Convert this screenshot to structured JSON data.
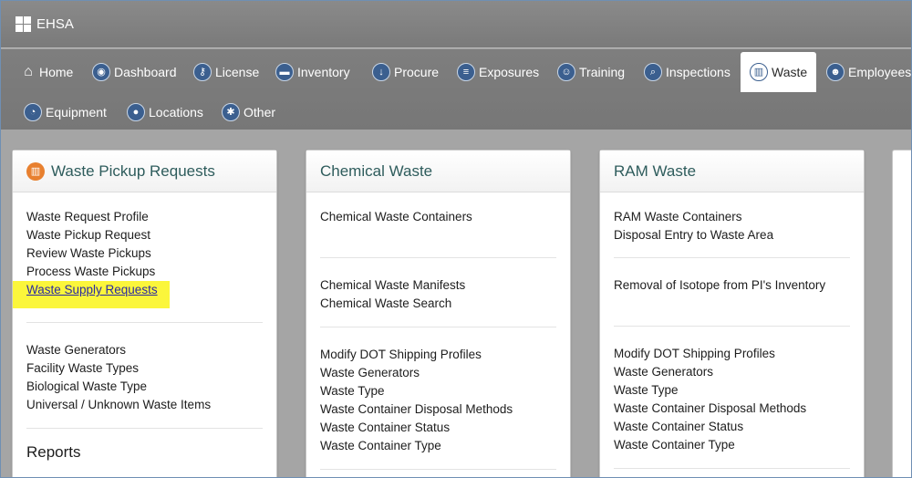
{
  "app": {
    "title": "EHSA"
  },
  "nav": {
    "items": [
      {
        "label": "Home"
      },
      {
        "label": "Dashboard"
      },
      {
        "label": "License"
      },
      {
        "label": "Inventory"
      },
      {
        "label": "Procure"
      },
      {
        "label": "Exposures"
      },
      {
        "label": "Training"
      },
      {
        "label": "Inspections"
      },
      {
        "label": "Waste"
      },
      {
        "label": "Employees"
      },
      {
        "label": "Equipment"
      },
      {
        "label": "Locations"
      },
      {
        "label": "Other"
      }
    ]
  },
  "panels": {
    "pickup": {
      "title": "Waste Pickup Requests",
      "group1": [
        "Waste Request Profile",
        "Waste Pickup Request",
        "Review Waste Pickups",
        "Process Waste Pickups",
        "Waste Supply Requests"
      ],
      "group2": [
        "Waste Generators",
        "Facility Waste Types",
        "Biological Waste Type",
        "Universal / Unknown Waste Items"
      ],
      "reports": "Reports"
    },
    "chemical": {
      "title": "Chemical Waste",
      "group1": [
        "Chemical Waste Containers"
      ],
      "group2": [
        "Chemical Waste Manifests",
        "Chemical Waste Search"
      ],
      "group3": [
        "Modify DOT Shipping Profiles",
        "Waste Generators",
        "Waste Type",
        "Waste Container Disposal Methods",
        "Waste Container Status",
        "Waste Container Type"
      ]
    },
    "ram": {
      "title": "RAM Waste",
      "group1": [
        "RAM Waste Containers",
        "Disposal Entry to Waste Area"
      ],
      "group2": [
        "Removal of Isotope from PI's Inventory"
      ],
      "group3": [
        "Modify DOT Shipping Profiles",
        "Waste Generators",
        "Waste Type",
        "Waste Container Disposal Methods",
        "Waste Container Status",
        "Waste Container Type"
      ]
    }
  },
  "colors": {
    "nav_icon": "#3b5f8f",
    "highlight": "#fbf63b",
    "panel_title": "#2e5c5c",
    "trash_icon": "#e8802f"
  }
}
